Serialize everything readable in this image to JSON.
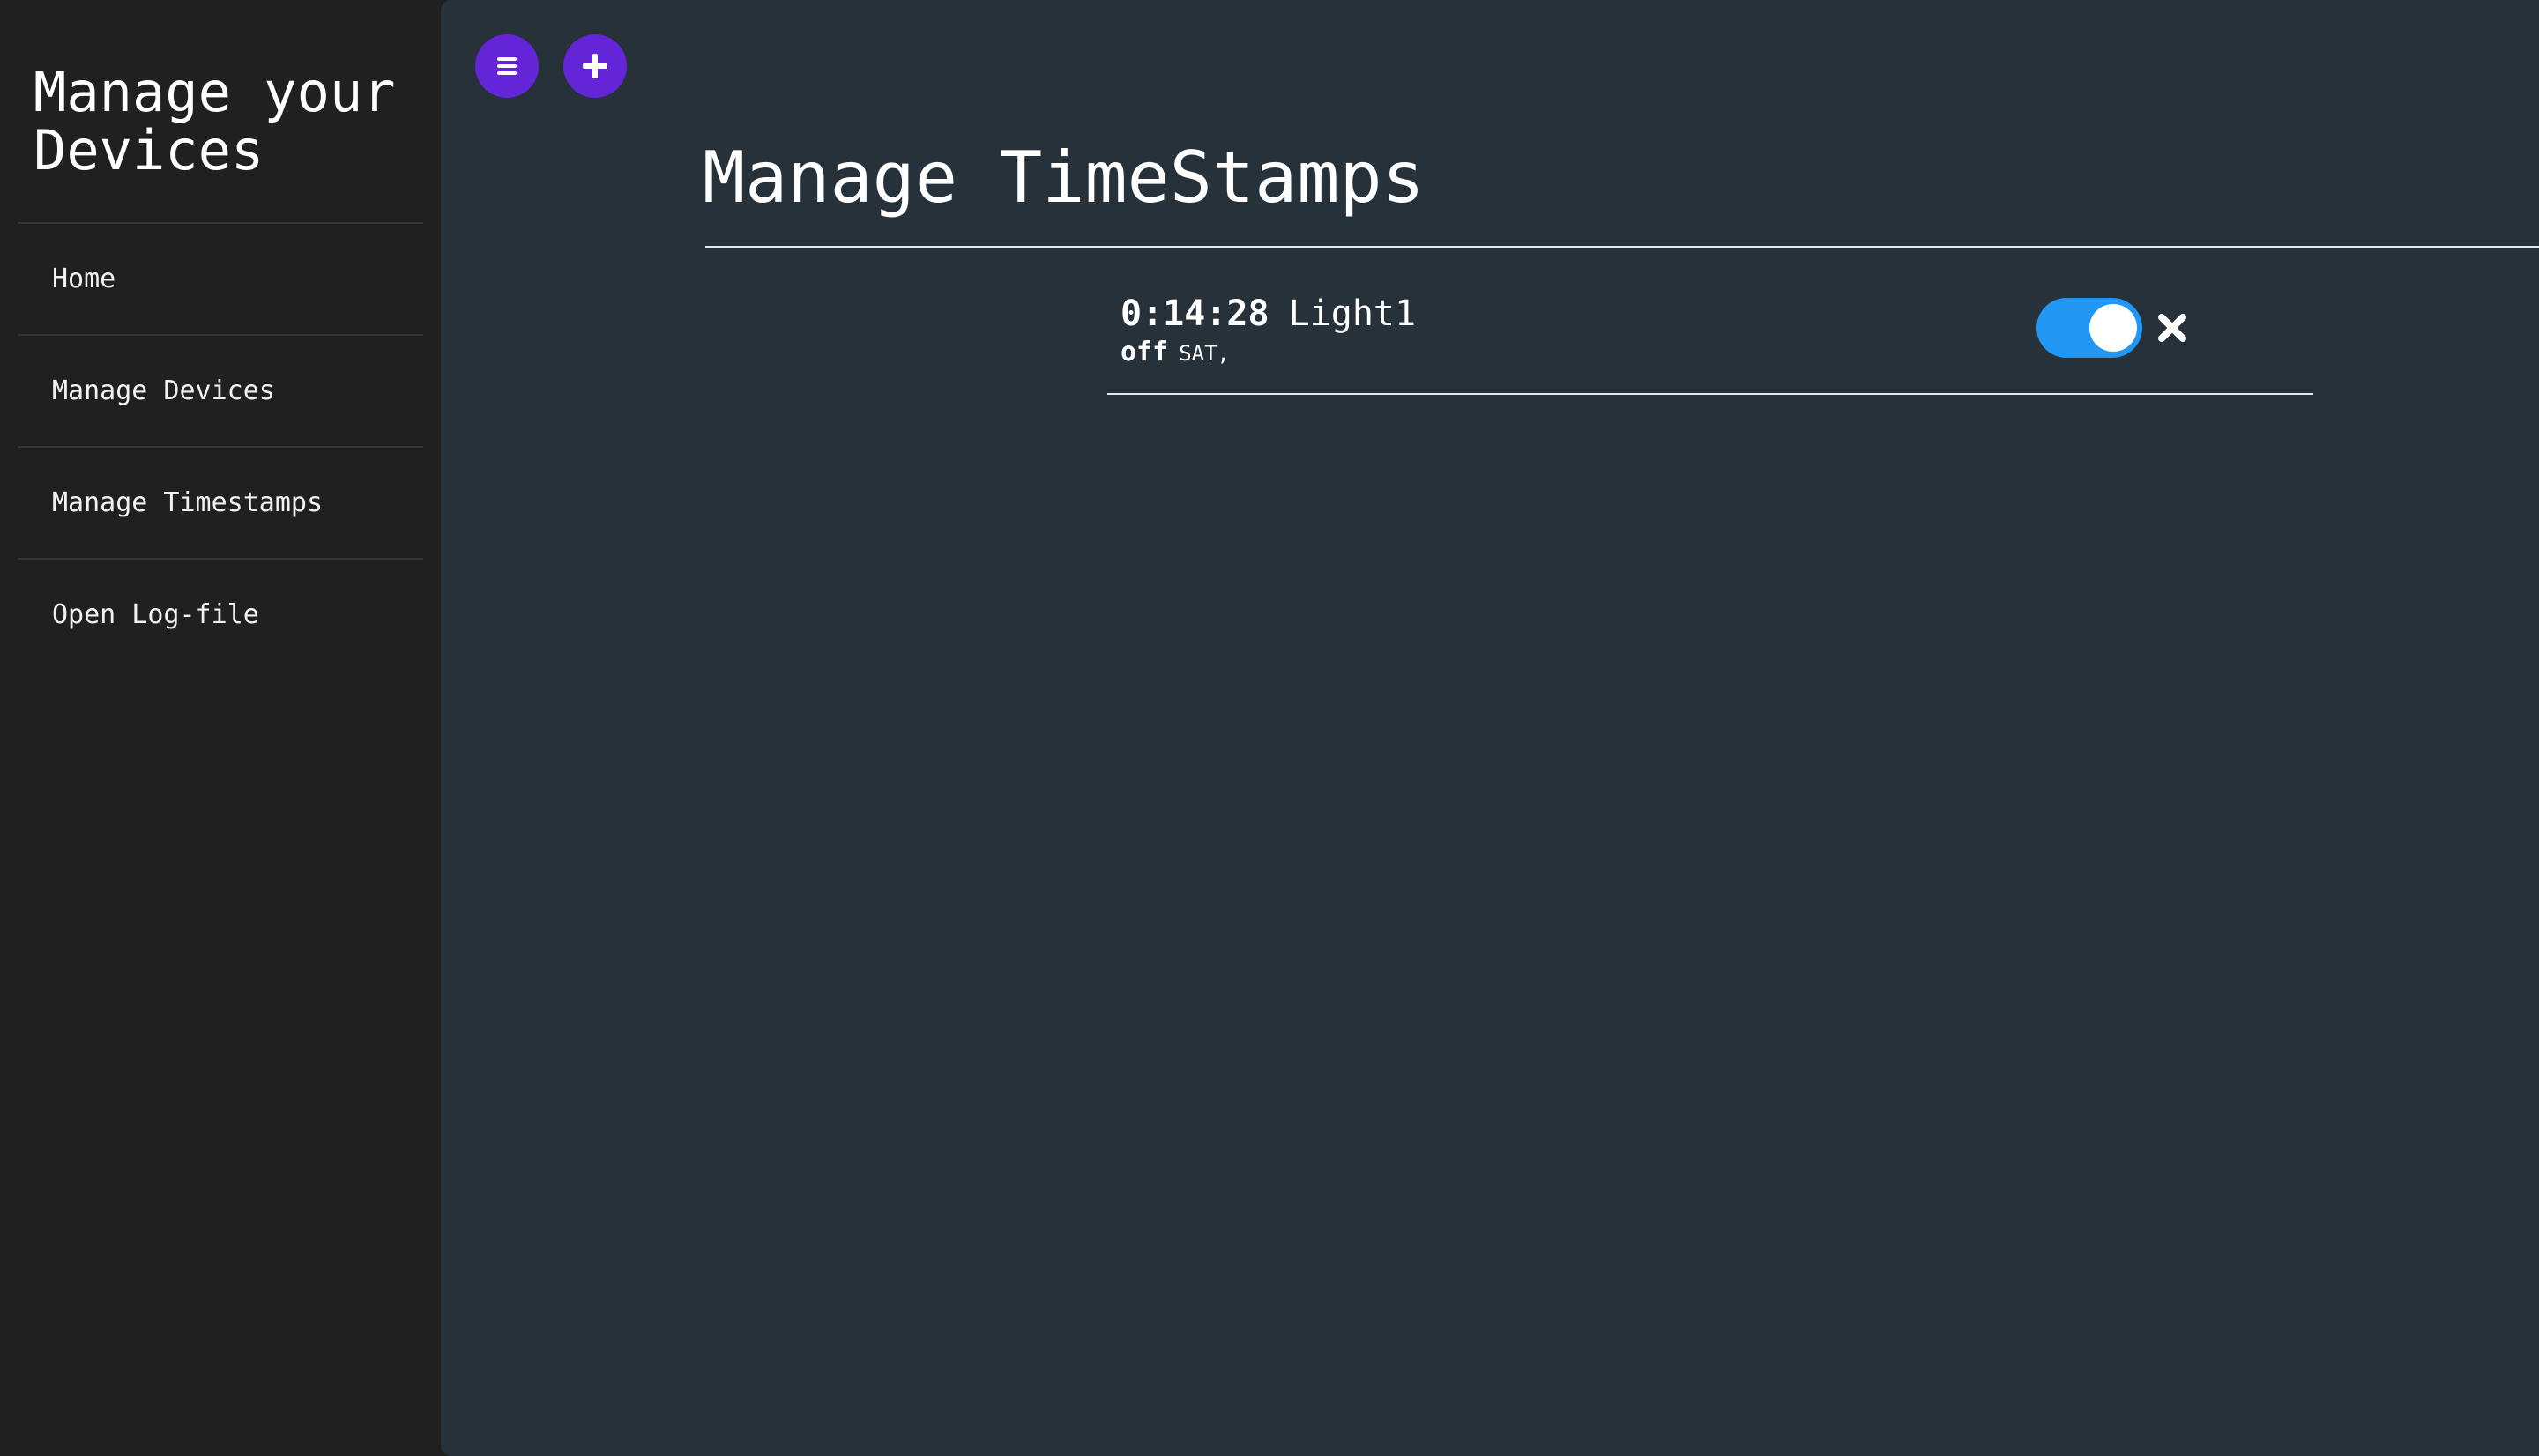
{
  "sidebar": {
    "title": "Manage your Devices",
    "items": [
      {
        "label": "Home"
      },
      {
        "label": "Manage Devices"
      },
      {
        "label": "Manage Timestamps"
      },
      {
        "label": "Open Log-file"
      }
    ]
  },
  "toolbar": {
    "menu_icon": "hamburger-menu-icon",
    "add_icon": "plus-icon"
  },
  "main": {
    "title": "Manage TimeStamps",
    "entries": [
      {
        "time": "0:14:28",
        "device": "Light1",
        "state": "off",
        "days": "SAT,",
        "enabled": true
      }
    ]
  },
  "colors": {
    "sidebar_bg": "#202020",
    "main_bg": "#27313a",
    "accent_purple": "#6425d8",
    "toggle_on": "#2196f3"
  }
}
